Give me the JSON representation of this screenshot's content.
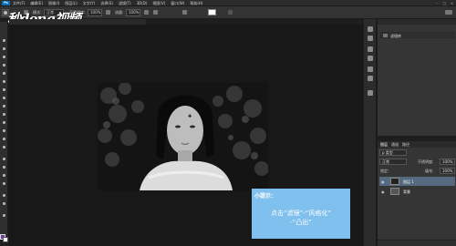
{
  "app": {
    "logo_text": "Ps"
  },
  "menu": [
    "文件(F)",
    "编辑(E)",
    "图像(I)",
    "图层(L)",
    "文字(Y)",
    "选择(S)",
    "滤镜(T)",
    "3D(D)",
    "视图(V)",
    "窗口(W)",
    "帮助(H)"
  ],
  "options": {
    "mode_label": "模式:",
    "mode_value": "正常",
    "opacity_label": "不透明度:",
    "opacity_value": "100%",
    "flow_label": "流量:",
    "flow_value": "100%"
  },
  "brand": {
    "text": "秒dong视频"
  },
  "history_panel": {
    "item": "滤镜库"
  },
  "layers_panel": {
    "tabs": [
      "图层",
      "通道",
      "路径"
    ],
    "filter_value": "p 类型",
    "blend_mode": "正常",
    "opacity_label": "不透明度:",
    "opacity_value": "100%",
    "lock_label": "锁定:",
    "fill_label": "填充:",
    "fill_value": "100%",
    "layers": [
      {
        "name": "图层 1",
        "active": true
      },
      {
        "name": "背景",
        "active": false
      }
    ]
  },
  "tip": {
    "title": "小提示：",
    "line1": "点击“滤镜”-“风格化”",
    "line2": "-“凸出”"
  },
  "colors": {
    "tip_bg": "#7fc0ee",
    "foreground_swatch": "#6a3aa8",
    "background_swatch": "#ffffff",
    "active_layer": "#566a7f"
  }
}
